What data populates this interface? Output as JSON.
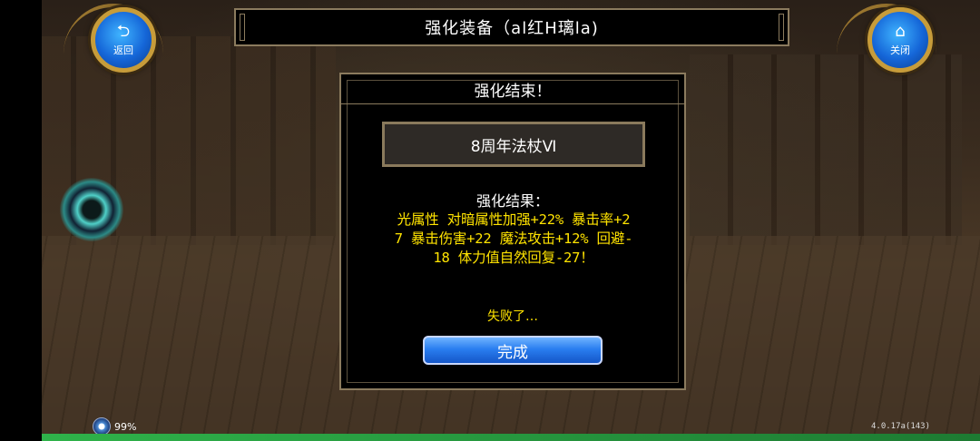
{
  "header": {
    "title": "强化装备（al红H璃la)",
    "back_label": "返回",
    "back_icon": "return-arrow-icon",
    "close_label": "关闭",
    "close_icon": "home-icon"
  },
  "dialog": {
    "title": "强化结束！",
    "item_name": "8周年法杖Ⅵ",
    "result_label": "强化结果：",
    "result_lines": [
      "光属性 对暗属性加强+22% 暴击率+2",
      "7 暴击伤害+22 魔法攻击+12% 回避-",
      "18 体力值自然回复-27！"
    ],
    "fail_text": "失败了…",
    "done_label": "完成"
  },
  "status": {
    "battery": "99%",
    "version": "4.0.17a(143)"
  },
  "colors": {
    "result_text": "#ffe300",
    "frame": "#8b7b5e",
    "button_blue": "#2a7ef0"
  }
}
